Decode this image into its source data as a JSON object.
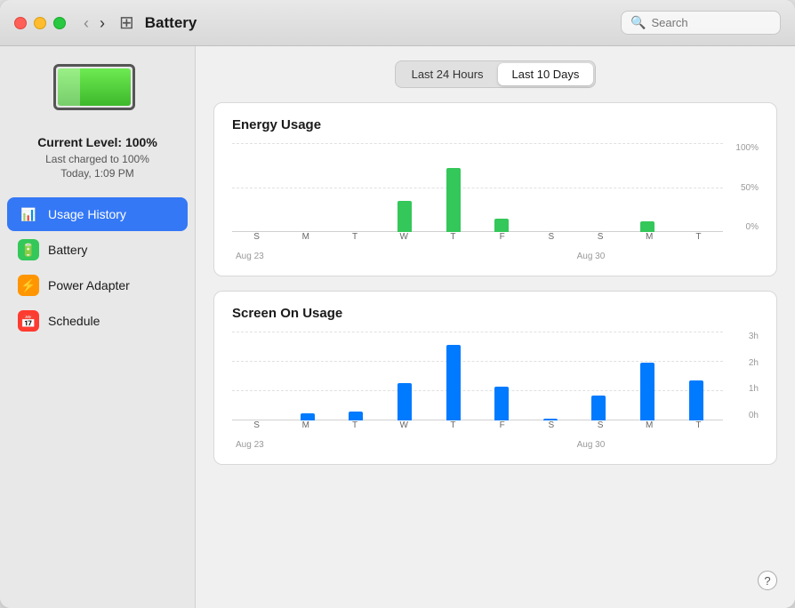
{
  "window": {
    "title": "Battery"
  },
  "titleBar": {
    "backLabel": "‹",
    "forwardLabel": "›",
    "searchPlaceholder": "Search"
  },
  "sidebar": {
    "batteryStatus": {
      "level": "Current Level: 100%",
      "lastCharged": "Last charged to 100%",
      "time": "Today, 1:09 PM"
    },
    "navItems": [
      {
        "id": "usage-history",
        "label": "Usage History",
        "icon": "📊",
        "iconClass": "icon-usage",
        "active": true
      },
      {
        "id": "battery",
        "label": "Battery",
        "icon": "🔋",
        "iconClass": "icon-battery",
        "active": false
      },
      {
        "id": "power-adapter",
        "label": "Power Adapter",
        "icon": "⚡",
        "iconClass": "icon-power",
        "active": false
      },
      {
        "id": "schedule",
        "label": "Schedule",
        "icon": "📅",
        "iconClass": "icon-schedule",
        "active": false
      }
    ]
  },
  "tabs": [
    {
      "id": "last24h",
      "label": "Last 24 Hours",
      "active": false
    },
    {
      "id": "last10d",
      "label": "Last 10 Days",
      "active": true
    }
  ],
  "energyChart": {
    "title": "Energy Usage",
    "yLabels": [
      "100%",
      "50%",
      "0%"
    ],
    "xLabels": [
      {
        "day": "S",
        "sub": ""
      },
      {
        "day": "M",
        "sub": ""
      },
      {
        "day": "T",
        "sub": ""
      },
      {
        "day": "W",
        "sub": ""
      },
      {
        "day": "T",
        "sub": ""
      },
      {
        "day": "F",
        "sub": ""
      },
      {
        "day": "S",
        "sub": ""
      },
      {
        "day": "S",
        "sub": ""
      },
      {
        "day": "M",
        "sub": ""
      },
      {
        "day": "T",
        "sub": ""
      }
    ],
    "dateLabels": [
      "Aug 23",
      "Aug 30"
    ],
    "bars": [
      0,
      0,
      0,
      35,
      72,
      15,
      0,
      0,
      12,
      0
    ]
  },
  "screenChart": {
    "title": "Screen On Usage",
    "yLabels": [
      "3h",
      "2h",
      "1h",
      "0h"
    ],
    "xLabels": [
      {
        "day": "S",
        "sub": ""
      },
      {
        "day": "M",
        "sub": ""
      },
      {
        "day": "T",
        "sub": ""
      },
      {
        "day": "W",
        "sub": ""
      },
      {
        "day": "T",
        "sub": ""
      },
      {
        "day": "F",
        "sub": ""
      },
      {
        "day": "S",
        "sub": ""
      },
      {
        "day": "S",
        "sub": ""
      },
      {
        "day": "M",
        "sub": ""
      },
      {
        "day": "T",
        "sub": ""
      }
    ],
    "dateLabels": [
      "Aug 23",
      "Aug 30"
    ],
    "bars": [
      0,
      8,
      10,
      42,
      85,
      38,
      2,
      28,
      65,
      45
    ]
  },
  "help": "?"
}
